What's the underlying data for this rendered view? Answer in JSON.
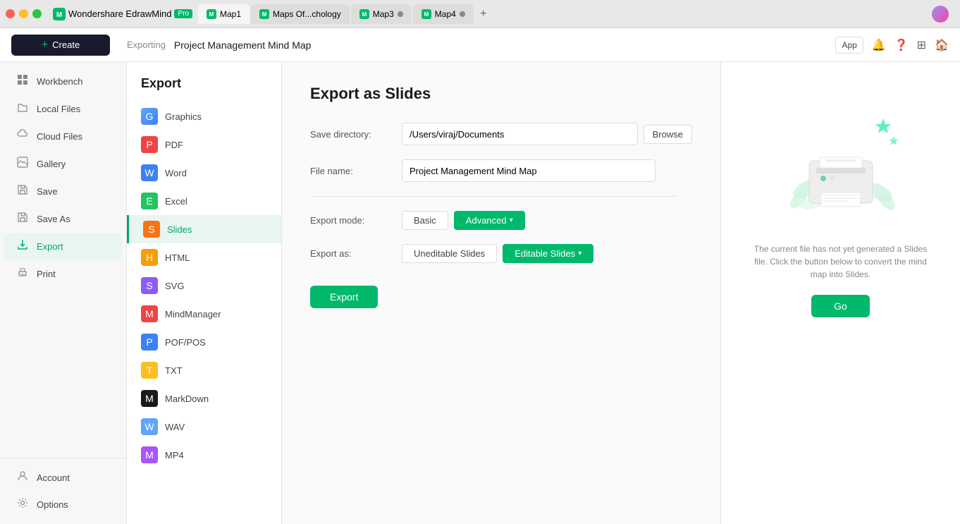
{
  "titlebar": {
    "app_name": "Wondershare EdrawMind",
    "app_badge": "Pro",
    "tabs": [
      {
        "id": "tab1",
        "label": "Map1",
        "active": false,
        "modified": false
      },
      {
        "id": "tab2",
        "label": "Maps Of...chology",
        "active": false,
        "modified": false
      },
      {
        "id": "tab3",
        "label": "Map3",
        "active": false,
        "modified": true
      },
      {
        "id": "tab4",
        "label": "Map4",
        "active": false,
        "modified": true
      }
    ],
    "new_tab_label": "+"
  },
  "header": {
    "create_label": "Create",
    "breadcrumb_prefix": "Exporting",
    "map_name": "Project Management Mind Map",
    "app_btn_label": "App"
  },
  "sidebar": {
    "items": [
      {
        "id": "workbench",
        "label": "Workbench",
        "icon": "🗂"
      },
      {
        "id": "local-files",
        "label": "Local Files",
        "icon": "📁"
      },
      {
        "id": "cloud-files",
        "label": "Cloud Files",
        "icon": "☁️"
      },
      {
        "id": "gallery",
        "label": "Gallery",
        "icon": "🖼"
      },
      {
        "id": "save",
        "label": "Save",
        "icon": "💾"
      },
      {
        "id": "save-as",
        "label": "Save As",
        "icon": "💾"
      },
      {
        "id": "export",
        "label": "Export",
        "icon": "📤",
        "active": true
      },
      {
        "id": "print",
        "label": "Print",
        "icon": "🖨"
      }
    ],
    "bottom_items": [
      {
        "id": "account",
        "label": "Account",
        "icon": "👤"
      },
      {
        "id": "options",
        "label": "Options",
        "icon": "⚙️"
      }
    ]
  },
  "export_panel": {
    "title": "Export",
    "items": [
      {
        "id": "graphics",
        "label": "Graphics",
        "icon": "G",
        "icon_class": "icon-graphics"
      },
      {
        "id": "pdf",
        "label": "PDF",
        "icon": "P",
        "icon_class": "icon-pdf"
      },
      {
        "id": "word",
        "label": "Word",
        "icon": "W",
        "icon_class": "icon-word"
      },
      {
        "id": "excel",
        "label": "Excel",
        "icon": "E",
        "icon_class": "icon-excel"
      },
      {
        "id": "slides",
        "label": "Slides",
        "icon": "S",
        "icon_class": "icon-slides",
        "active": true
      },
      {
        "id": "html",
        "label": "HTML",
        "icon": "H",
        "icon_class": "icon-html"
      },
      {
        "id": "svg",
        "label": "SVG",
        "icon": "S",
        "icon_class": "icon-svg"
      },
      {
        "id": "mindmanager",
        "label": "MindManager",
        "icon": "M",
        "icon_class": "icon-mindmanager"
      },
      {
        "id": "pof",
        "label": "POF/POS",
        "icon": "P",
        "icon_class": "icon-pof"
      },
      {
        "id": "txt",
        "label": "TXT",
        "icon": "T",
        "icon_class": "icon-txt"
      },
      {
        "id": "markdown",
        "label": "MarkDown",
        "icon": "M",
        "icon_class": "icon-markdown"
      },
      {
        "id": "wav",
        "label": "WAV",
        "icon": "W",
        "icon_class": "icon-wav"
      },
      {
        "id": "mp4",
        "label": "MP4",
        "icon": "M",
        "icon_class": "icon-mp4"
      }
    ]
  },
  "form": {
    "title": "Export as Slides",
    "save_directory_label": "Save directory:",
    "save_directory_value": "/Users/viraj/Documents",
    "browse_label": "Browse",
    "file_name_label": "File name:",
    "file_name_value": "Project Management Mind Map",
    "export_mode_label": "Export mode:",
    "export_mode_basic": "Basic",
    "export_mode_advanced": "Advanced",
    "export_as_label": "Export as:",
    "export_as_option1": "Uneditable Slides",
    "export_as_option2": "Editable Slides",
    "export_button_label": "Export"
  },
  "preview": {
    "text": "The current file has not yet generated a Slides file. Click the button below to convert the mind map into Slides.",
    "go_label": "Go"
  }
}
